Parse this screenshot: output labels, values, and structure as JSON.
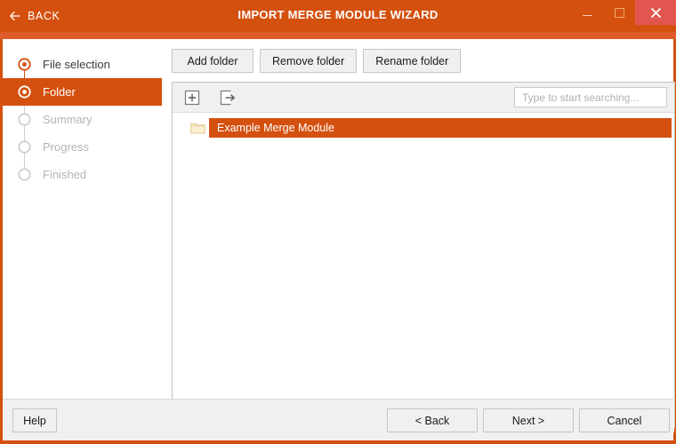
{
  "titlebar": {
    "back_label": "BACK",
    "back_icon": "arrow-left-icon",
    "title": "IMPORT MERGE MODULE WIZARD",
    "minimize_icon": "minimize-icon",
    "maximize_icon": "maximize-icon",
    "close_icon": "close-icon",
    "bg_color": "#d4500f",
    "strip_color": "#e05b2a",
    "close_bg_color": "#e1574f"
  },
  "sidebar": {
    "steps": [
      {
        "label": "File selection",
        "state": "done"
      },
      {
        "label": "Folder",
        "state": "active"
      },
      {
        "label": "Summary",
        "state": "pending"
      },
      {
        "label": "Progress",
        "state": "pending"
      },
      {
        "label": "Finished",
        "state": "pending"
      }
    ],
    "accent_color": "#d4500f",
    "pending_color": "#b4b4b4"
  },
  "toolbar": {
    "add_folder_label": "Add folder",
    "remove_folder_label": "Remove folder",
    "rename_folder_label": "Rename folder"
  },
  "tree": {
    "expand_icon": "expand-all-icon",
    "collapse_icon": "collapse-all-icon",
    "search": {
      "placeholder": "Type to start searching...",
      "value": "",
      "icon": "search-icon"
    },
    "items": [
      {
        "label": "Example Merge Module",
        "icon": "folder-icon",
        "selected": true
      }
    ],
    "selection_color": "#d4500f"
  },
  "footer": {
    "help_label": "Help",
    "back_label": "< Back",
    "next_label": "Next >",
    "cancel_label": "Cancel"
  }
}
